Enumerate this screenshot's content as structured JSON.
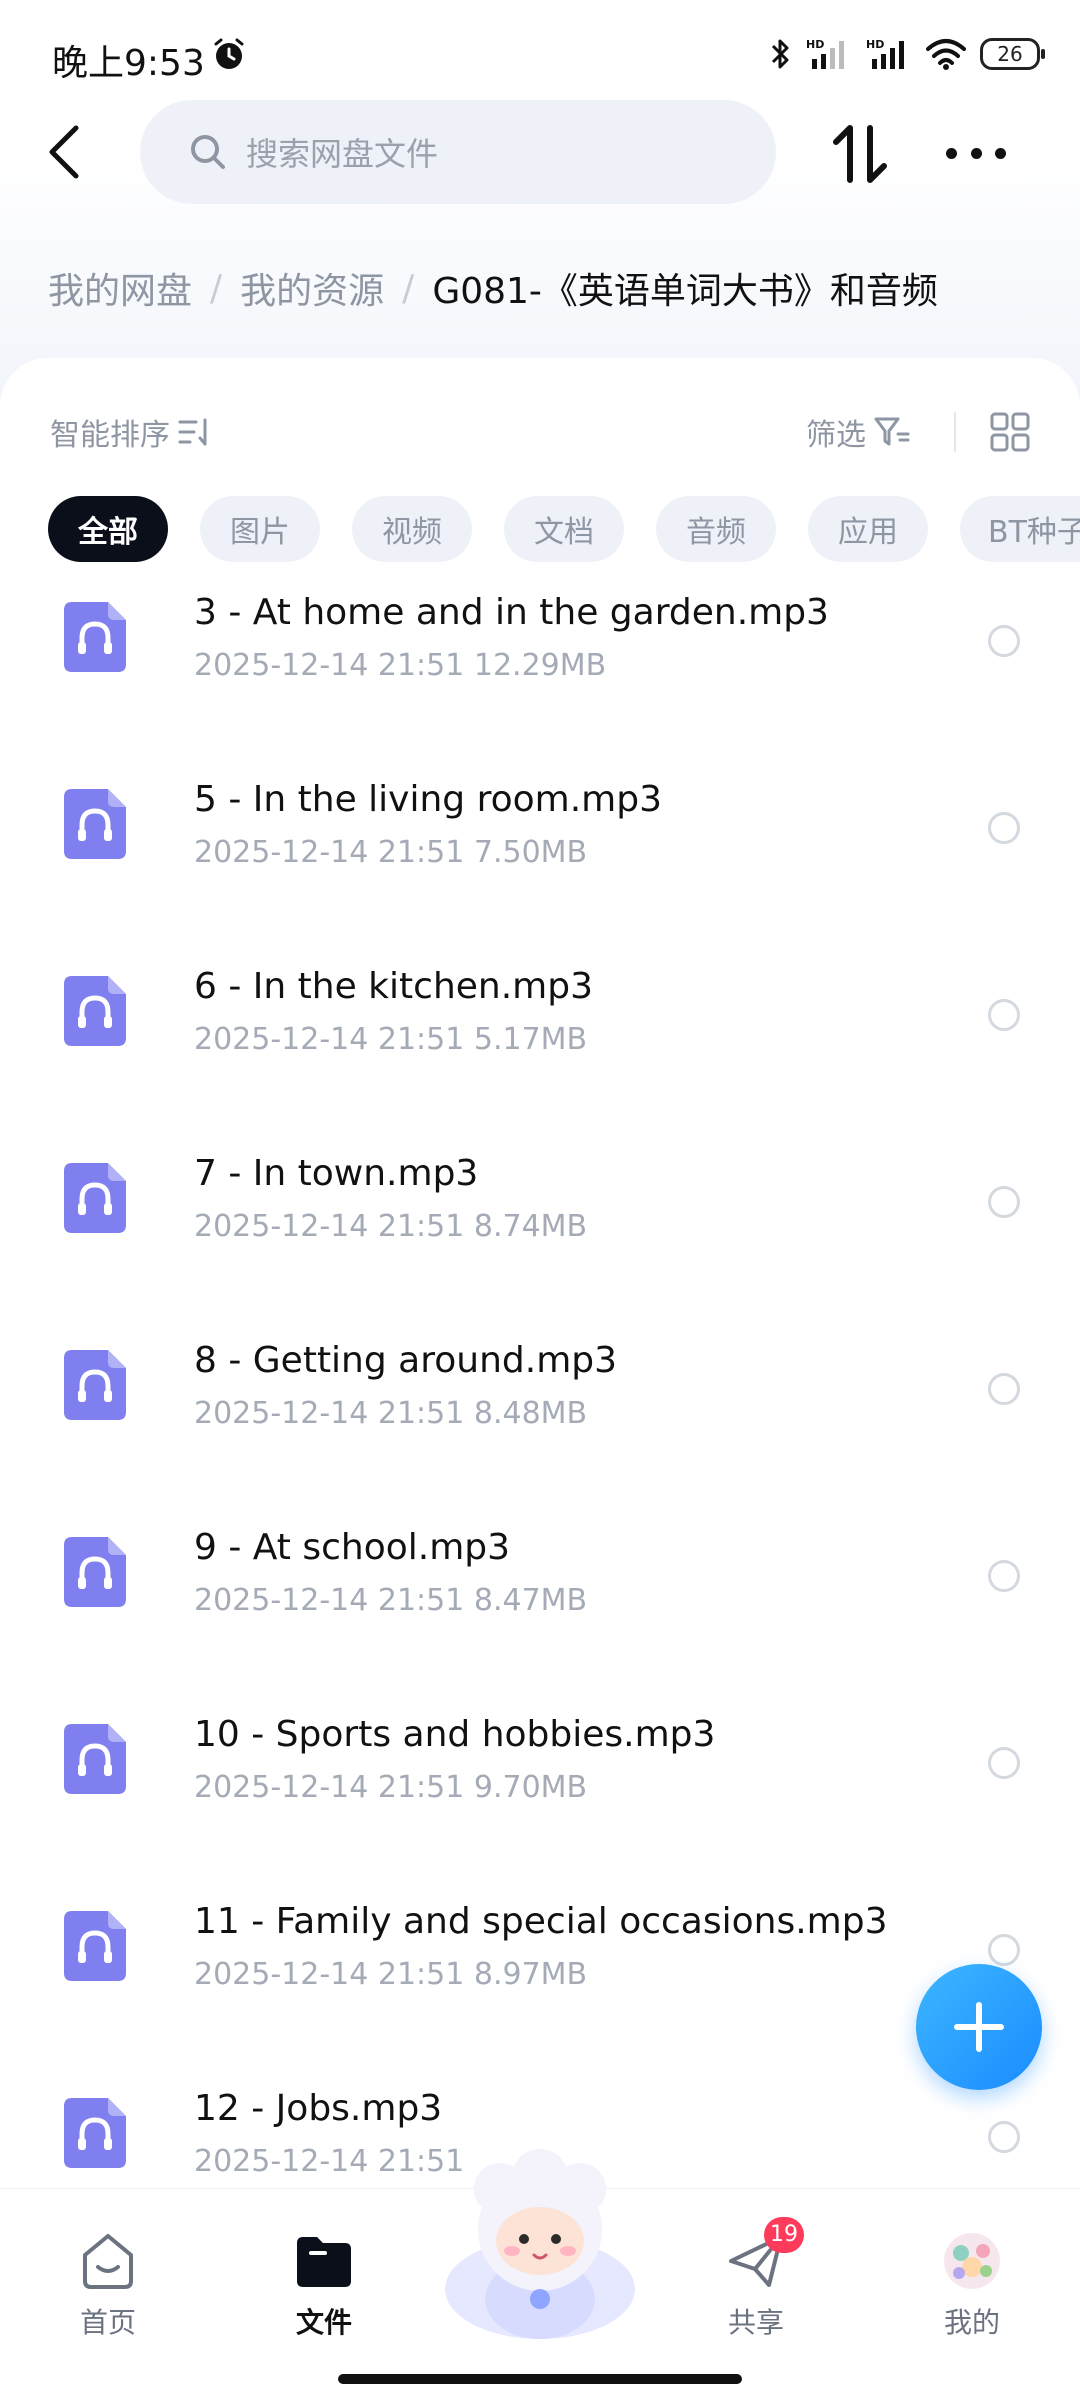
{
  "status_bar": {
    "time": "晚上9:53",
    "battery": "26"
  },
  "header": {
    "search_placeholder": "搜索网盘文件"
  },
  "breadcrumb": {
    "items": [
      "我的网盘",
      "我的资源"
    ],
    "separator": "/",
    "current": "G081-《英语单词大书》和音频"
  },
  "toolbar": {
    "sort_label": "智能排序",
    "filter_label": "筛选"
  },
  "chips": [
    "全部",
    "图片",
    "视频",
    "文档",
    "音频",
    "应用",
    "BT种子"
  ],
  "files": [
    {
      "name": "3 - At home and in the garden.mp3",
      "meta": "2025-12-14   21:51   12.29MB"
    },
    {
      "name": "5 - In the living room.mp3",
      "meta": "2025-12-14   21:51   7.50MB"
    },
    {
      "name": "6 - In the kitchen.mp3",
      "meta": "2025-12-14   21:51   5.17MB"
    },
    {
      "name": "7 - In town.mp3",
      "meta": "2025-12-14   21:51   8.74MB"
    },
    {
      "name": "8 - Getting around.mp3",
      "meta": "2025-12-14   21:51   8.48MB"
    },
    {
      "name": "9 - At school.mp3",
      "meta": "2025-12-14   21:51   8.47MB"
    },
    {
      "name": "10 - Sports and hobbies.mp3",
      "meta": "2025-12-14   21:51   9.70MB"
    },
    {
      "name": "11 - Family and special occasions.mp3",
      "meta": "2025-12-14   21:51   8.97MB"
    },
    {
      "name": "12 - Jobs.mp3",
      "meta": "2025-12-14   21:51"
    }
  ],
  "bottom_nav": {
    "home": "首页",
    "files": "文件",
    "share": "共享",
    "share_badge": "19",
    "me": "我的"
  },
  "colors": {
    "accent": "#1a8cff",
    "file_icon": "#7f7ff0",
    "badge": "#ff3b5c"
  }
}
